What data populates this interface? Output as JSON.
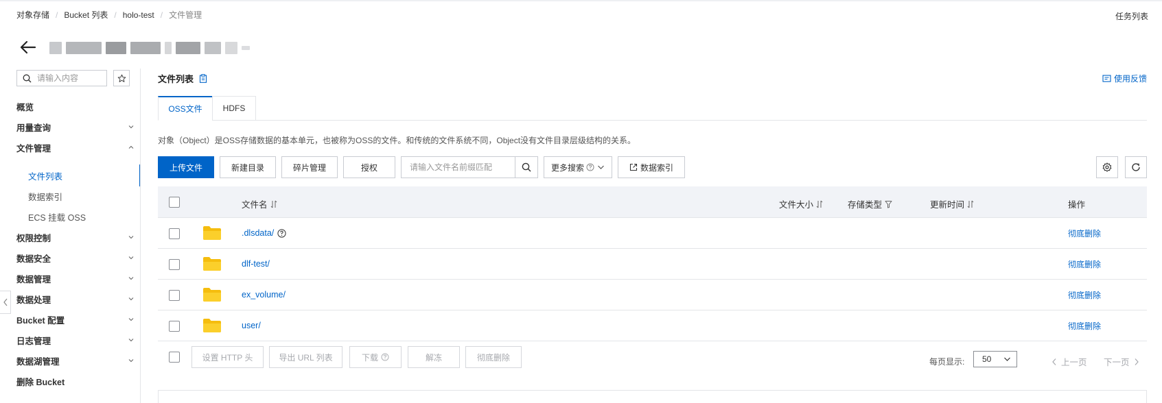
{
  "breadcrumb": {
    "items": [
      "对象存储",
      "Bucket 列表",
      "holo-test",
      "文件管理"
    ]
  },
  "header": {
    "task_list": "任务列表"
  },
  "sidebar": {
    "search_placeholder": "请输入内容",
    "items": [
      {
        "label": "概览",
        "expandable": false
      },
      {
        "label": "用量查询",
        "expandable": true
      },
      {
        "label": "文件管理",
        "expandable": true,
        "expanded": true
      },
      {
        "label": "文件列表",
        "sub": true,
        "active": true
      },
      {
        "label": "数据索引",
        "sub": true
      },
      {
        "label": "ECS 挂载 OSS",
        "sub": true
      },
      {
        "label": "权限控制",
        "expandable": true
      },
      {
        "label": "数据安全",
        "expandable": true
      },
      {
        "label": "数据管理",
        "expandable": true
      },
      {
        "label": "数据处理",
        "expandable": true
      },
      {
        "label": "Bucket 配置",
        "expandable": true
      },
      {
        "label": "日志管理",
        "expandable": true
      },
      {
        "label": "数据湖管理",
        "expandable": true
      },
      {
        "label": "删除 Bucket",
        "expandable": false
      }
    ]
  },
  "main": {
    "title": "文件列表",
    "feedback": "使用反馈",
    "tabs": [
      {
        "label": "OSS文件",
        "active": true
      },
      {
        "label": "HDFS",
        "active": false
      }
    ],
    "description": "对象（Object）是OSS存储数据的基本单元，也被称为OSS的文件。和传统的文件系统不同，Object没有文件目录层级结构的关系。",
    "toolbar": {
      "upload": "上传文件",
      "new_dir": "新建目录",
      "fragments": "碎片管理",
      "authorize": "授权",
      "search_placeholder": "请输入文件名前缀匹配",
      "more_search": "更多搜索",
      "data_index": "数据索引"
    },
    "table": {
      "columns": {
        "name": "文件名",
        "size": "文件大小",
        "storage": "存储类型",
        "updated": "更新时间",
        "actions": "操作"
      },
      "rows": [
        {
          "name": ".dlsdata/",
          "help": true,
          "action": "彻底删除"
        },
        {
          "name": "dlf-test/",
          "help": false,
          "action": "彻底删除"
        },
        {
          "name": "ex_volume/",
          "help": false,
          "action": "彻底删除"
        },
        {
          "name": "user/",
          "help": false,
          "action": "彻底删除"
        }
      ]
    },
    "footer": {
      "set_http_header": "设置 HTTP 头",
      "export_urls": "导出 URL 列表",
      "download": "下载",
      "unfreeze": "解冻",
      "delete_all": "彻底删除",
      "page_size_label": "每页显示:",
      "page_size": "50",
      "prev": "上一页",
      "next": "下一页"
    }
  },
  "colors": {
    "primary": "#0064c8",
    "folder": "#f7c514",
    "header_bg": "#f1f3f7"
  }
}
